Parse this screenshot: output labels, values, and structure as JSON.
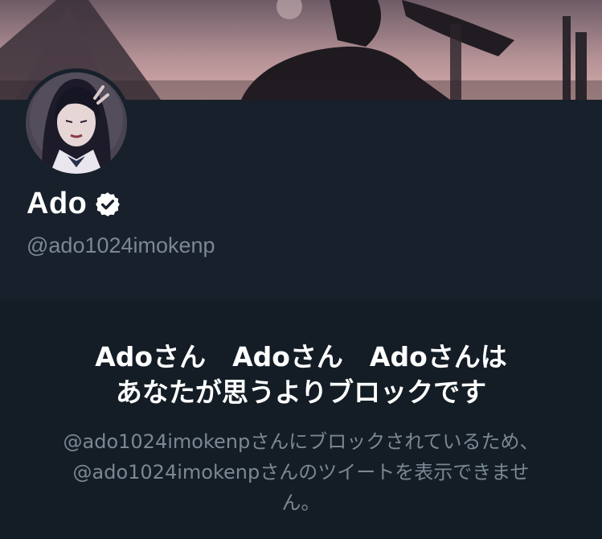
{
  "profile": {
    "display_name": "Ado",
    "handle": "@ado1024imokenp",
    "verified_icon": "verified-badge-icon"
  },
  "blocked_notice": {
    "title_lines": [
      "Adoさん　Adoさん　Adoさんは",
      "あなたが思うよりブロックです"
    ],
    "message_lines": [
      "@ado1024imokenpさんにブロックされているため、",
      "@ado1024imokenpさんのツイートを表示できませ",
      "ん。"
    ]
  },
  "colors": {
    "background": "#141d26",
    "panel": "#17202b",
    "text_primary": "#ffffff",
    "text_secondary": "#7a8894"
  }
}
